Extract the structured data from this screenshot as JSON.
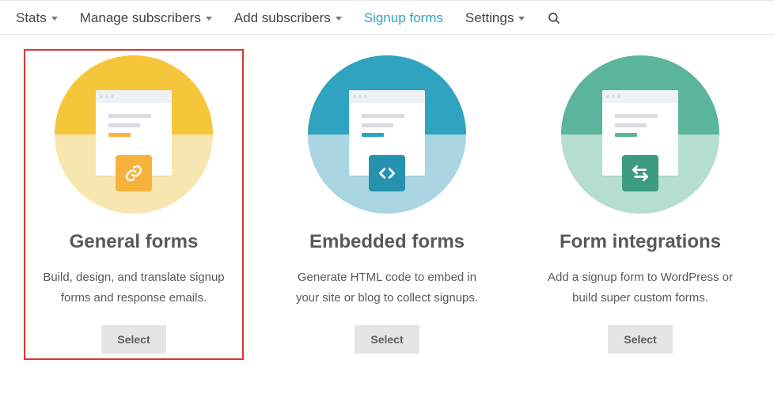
{
  "tabs": {
    "stats": "Stats",
    "manage": "Manage subscribers",
    "add": "Add subscribers",
    "signup": "Signup forms",
    "settings": "Settings"
  },
  "cards": {
    "general": {
      "title": "General forms",
      "desc": "Build, design, and translate signup forms and response emails.",
      "button": "Select"
    },
    "embedded": {
      "title": "Embedded forms",
      "desc": "Generate HTML code to embed in your site or blog to collect signups.",
      "button": "Select"
    },
    "integrations": {
      "title": "Form integrations",
      "desc": "Add a signup form to WordPress or build super custom forms.",
      "button": "Select"
    }
  }
}
